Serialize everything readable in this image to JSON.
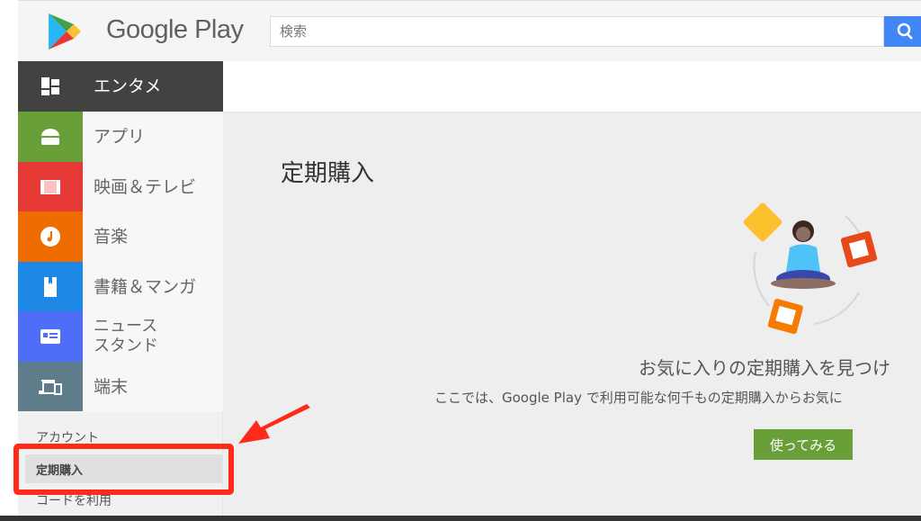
{
  "header": {
    "logo_text": "Google Play",
    "search_placeholder": "検索"
  },
  "sidebar": {
    "items": [
      {
        "label": "エンタメ",
        "icon": "grid-icon",
        "color": "#424242"
      },
      {
        "label": "アプリ",
        "icon": "android-icon",
        "color": "#689f38"
      },
      {
        "label": "映画＆テレビ",
        "icon": "film-icon",
        "color": "#e53935"
      },
      {
        "label": "音楽",
        "icon": "music-icon",
        "color": "#ef6c00"
      },
      {
        "label": "書籍＆マンガ",
        "icon": "book-icon",
        "color": "#1e88e5"
      },
      {
        "label": "ニュース\nスタンド",
        "icon": "newsstand-icon",
        "color": "#4f6ef7"
      },
      {
        "label": "端末",
        "icon": "devices-icon",
        "color": "#607d8b"
      }
    ],
    "links": {
      "account": "アカウント",
      "subscriptions": "定期購入",
      "redeem": "コードを利用"
    }
  },
  "main": {
    "title": "定期購入",
    "heading": "お気に入りの定期購入を見つけ",
    "description": "ここでは、Google Play で利用可能な何千もの定期購入からお気に",
    "button": "使ってみる"
  },
  "annotation": {
    "highlight_color": "#ff2a1a"
  }
}
